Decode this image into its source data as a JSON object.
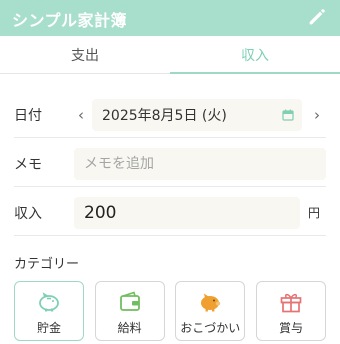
{
  "header": {
    "title": "シンプル家計簿",
    "edit_icon": "pencil-icon",
    "background": "#a8decc"
  },
  "tabs": [
    {
      "label": "支出",
      "active": false
    },
    {
      "label": "収入",
      "active": true
    }
  ],
  "form": {
    "date": {
      "label": "日付",
      "value": "2025年8月5日 (火)",
      "prev_icon": "chevron-left-icon",
      "next_icon": "chevron-right-icon",
      "calendar_icon": "calendar-icon"
    },
    "memo": {
      "label": "メモ",
      "placeholder": "メモを追加",
      "value": ""
    },
    "amount": {
      "label": "収入",
      "value": "200",
      "unit": "円"
    }
  },
  "categories": {
    "title": "カテゴリー",
    "items": [
      {
        "label": "貯金",
        "icon": "piggy-bank-icon",
        "color": "#7fcfb4",
        "selected": true
      },
      {
        "label": "給料",
        "icon": "wallet-icon",
        "color": "#6fbf5f",
        "selected": false
      },
      {
        "label": "おこづかい",
        "icon": "pig-icon",
        "color": "#f0a030",
        "selected": false
      },
      {
        "label": "賞与",
        "icon": "gift-icon",
        "color": "#e57373",
        "selected": false
      }
    ]
  },
  "colors": {
    "accent": "#7fcfb4",
    "input_bg": "#f8f7f1"
  }
}
